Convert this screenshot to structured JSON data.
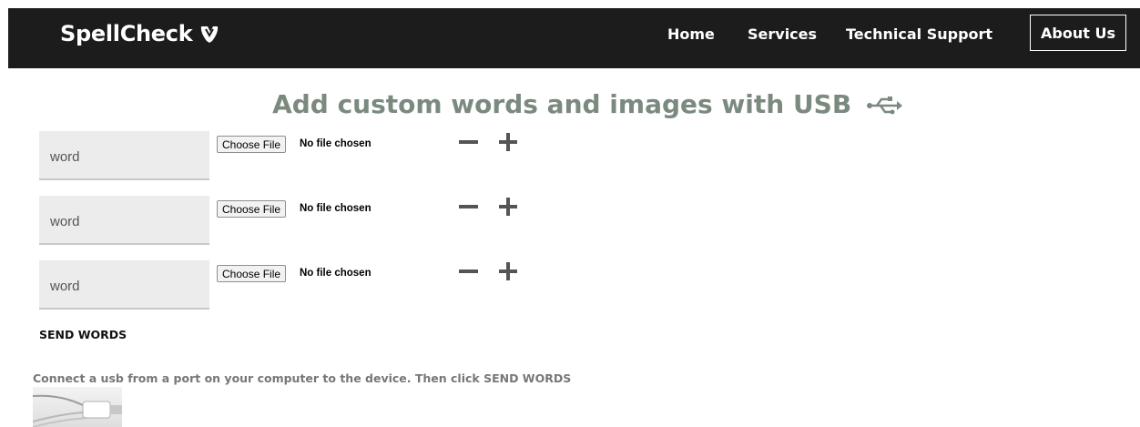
{
  "navbar": {
    "brand": "SpellCheck",
    "brand_icon": "typo3-shield-icon",
    "links": [
      "Home",
      "Services",
      "Technical Support"
    ],
    "about": "About Us"
  },
  "page": {
    "title": "Add custom words and images with USB",
    "title_icon": "usb-icon",
    "title_color": "#7b8a7e"
  },
  "rows": [
    {
      "placeholder": "word",
      "file_button": "Choose File",
      "file_status": "No file chosen"
    },
    {
      "placeholder": "word",
      "file_button": "Choose File",
      "file_status": "No file chosen"
    },
    {
      "placeholder": "word",
      "file_button": "Choose File",
      "file_status": "No file chosen"
    }
  ],
  "send_label": "SEND WORDS",
  "instructions": "Connect a usb from a port on your computer to the device. Then click SEND WORDS",
  "colors": {
    "navbar": "#1c1c1c",
    "input_bg": "#ececec"
  }
}
